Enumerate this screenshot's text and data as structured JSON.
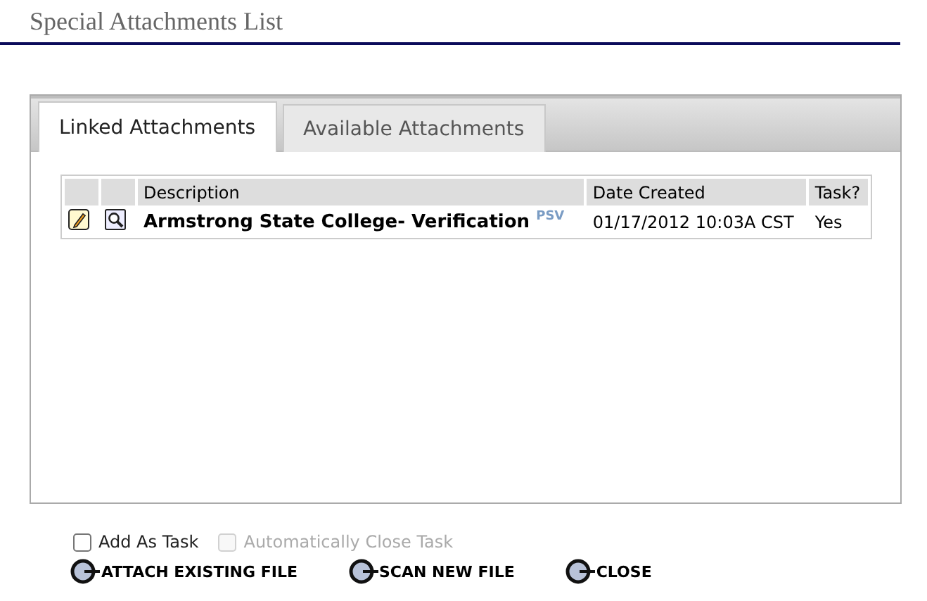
{
  "window": {
    "title": "Special Attachments List"
  },
  "tabs": [
    {
      "label": "Linked Attachments",
      "selected": true
    },
    {
      "label": "Available Attachments",
      "selected": false
    }
  ],
  "table": {
    "columns": [
      "Description",
      "Date Created",
      "Task?"
    ],
    "rows": [
      {
        "description": "Armstrong State College- Verification",
        "tag": "PSV",
        "date_created": "01/17/2012 10:03A CST",
        "task": "Yes"
      }
    ]
  },
  "options": [
    {
      "label": "Add As Task",
      "checked": false,
      "disabled": false
    },
    {
      "label": "Automatically Close Task",
      "checked": false,
      "disabled": true
    }
  ],
  "buttons": [
    "ATTACH EXISTING FILE",
    "SCAN NEW FILE",
    "CLOSE"
  ]
}
